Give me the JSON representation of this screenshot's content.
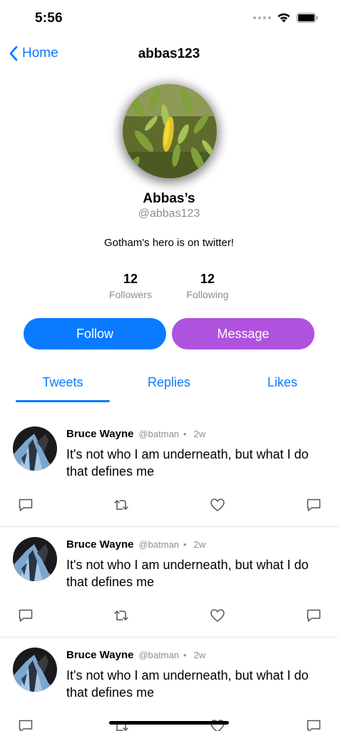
{
  "status": {
    "time": "5:56"
  },
  "nav": {
    "back_label": "Home",
    "title": "abbas123"
  },
  "profile": {
    "display_name": "Abbas’s",
    "handle": "@abbas123",
    "bio": "Gotham's hero is on twitter!",
    "followers_count": "12",
    "followers_label": "Followers",
    "following_count": "12",
    "following_label": "Following"
  },
  "actions": {
    "follow_label": "Follow",
    "message_label": "Message"
  },
  "tabs": {
    "tweets": "Tweets",
    "replies": "Replies",
    "likes": "Likes",
    "selected": "Tweets"
  },
  "tweets": [
    {
      "name": "Bruce Wayne",
      "handle": "@batman",
      "dot": "•",
      "time": "2w",
      "text": "It's not who I am underneath, but what I do that defines me"
    },
    {
      "name": "Bruce Wayne",
      "handle": "@batman",
      "dot": "•",
      "time": "2w",
      "text": "It's not who I am underneath, but what I do that defines me"
    },
    {
      "name": "Bruce Wayne",
      "handle": "@batman",
      "dot": "•",
      "time": "2w",
      "text": "It's not who I am underneath, but what I do that defines me"
    }
  ],
  "icons": {
    "back": "chevron-left-icon",
    "reply": "speech-bubble-icon",
    "retweet": "retweet-arrows-icon",
    "like": "heart-icon",
    "share": "speech-bubble-icon"
  },
  "colors": {
    "accent": "#0a7aff",
    "message": "#af52de",
    "secondary_text": "#8e8e93"
  }
}
